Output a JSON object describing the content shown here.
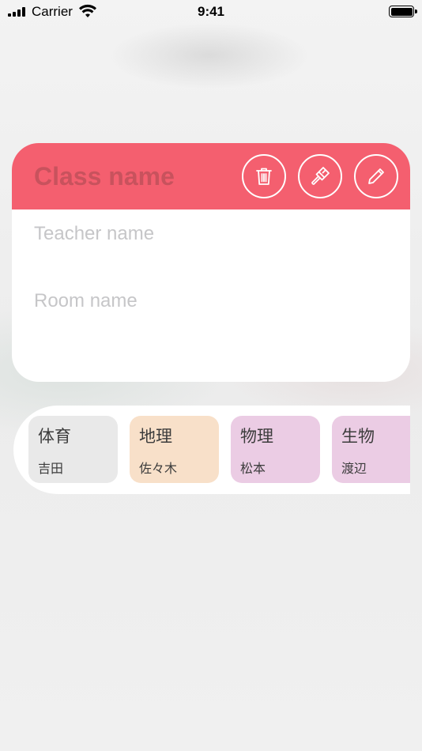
{
  "status_bar": {
    "carrier": "Carrier",
    "time": "9:41"
  },
  "class_card": {
    "accent_color": "#f45f6f",
    "class_name_placeholder": "Class name",
    "teacher_placeholder": "Teacher name",
    "room_placeholder": "Room name",
    "actions": [
      {
        "icon": "trash-icon"
      },
      {
        "icon": "paintbrush-icon"
      },
      {
        "icon": "pencil-icon"
      }
    ]
  },
  "subjects": [
    {
      "name": "体育",
      "teacher": "吉田",
      "color": "#e9e9e9"
    },
    {
      "name": "地理",
      "teacher": "佐々木",
      "color": "#f8e0c9"
    },
    {
      "name": "物理",
      "teacher": "松本",
      "color": "#ebcce4"
    },
    {
      "name": "生物",
      "teacher": "渡辺",
      "color": "#ebcce4"
    }
  ]
}
